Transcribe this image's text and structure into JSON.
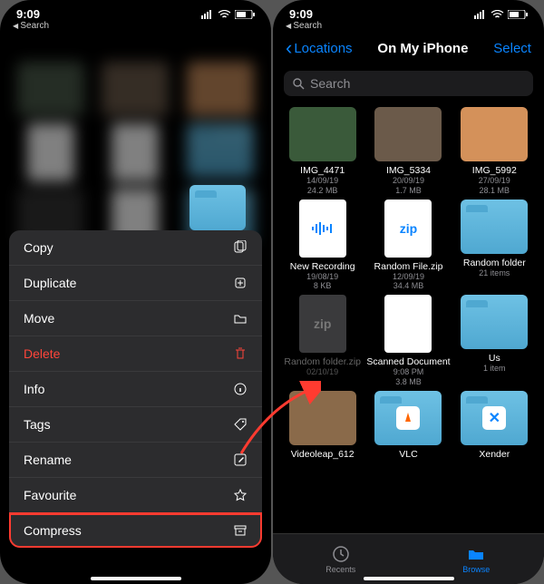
{
  "status": {
    "time": "9:09",
    "back": "Search"
  },
  "left": {
    "menu": [
      {
        "label": "Copy",
        "icon": "copy"
      },
      {
        "label": "Duplicate",
        "icon": "duplicate"
      },
      {
        "label": "Move",
        "icon": "folder"
      },
      {
        "label": "Delete",
        "icon": "trash",
        "danger": true
      },
      {
        "label": "Info",
        "icon": "info"
      },
      {
        "label": "Tags",
        "icon": "tag"
      },
      {
        "label": "Rename",
        "icon": "edit"
      },
      {
        "label": "Favourite",
        "icon": "star"
      },
      {
        "label": "Compress",
        "icon": "archive",
        "highlight": true
      }
    ]
  },
  "right": {
    "nav": {
      "back": "Locations",
      "title": "On My iPhone",
      "select": "Select"
    },
    "search": {
      "placeholder": "Search"
    },
    "files": [
      {
        "name": "IMG_4471",
        "meta1": "14/09/19",
        "meta2": "24.2 MB",
        "kind": "photo",
        "bg": "#3a5a3a"
      },
      {
        "name": "IMG_5334",
        "meta1": "20/09/19",
        "meta2": "1.7 MB",
        "kind": "photo",
        "bg": "#6b5a4a"
      },
      {
        "name": "IMG_5992",
        "meta1": "27/09/19",
        "meta2": "28.1 MB",
        "kind": "photo",
        "bg": "#d4915a"
      },
      {
        "name": "New Recording",
        "meta1": "19/08/19",
        "meta2": "8 KB",
        "kind": "audio"
      },
      {
        "name": "Random File.zip",
        "meta1": "12/09/19",
        "meta2": "34.4 MB",
        "kind": "zip"
      },
      {
        "name": "Random folder",
        "meta1": "21 items",
        "meta2": "",
        "kind": "folder"
      },
      {
        "name": "Random folder.zip",
        "meta1": "02/10/19",
        "meta2": "",
        "kind": "zip",
        "dim": true
      },
      {
        "name": "Scanned Document",
        "meta1": "9:08 PM",
        "meta2": "3.8 MB",
        "kind": "scan"
      },
      {
        "name": "Us",
        "meta1": "1 item",
        "meta2": "",
        "kind": "folder"
      },
      {
        "name": "Videoleap_612",
        "meta1": "",
        "meta2": "",
        "kind": "photo",
        "bg": "#8a6a4a"
      },
      {
        "name": "VLC",
        "meta1": "",
        "meta2": "",
        "kind": "app-vlc"
      },
      {
        "name": "Xender",
        "meta1": "",
        "meta2": "",
        "kind": "app-xender"
      }
    ],
    "tabs": {
      "recents": "Recents",
      "browse": "Browse"
    }
  }
}
